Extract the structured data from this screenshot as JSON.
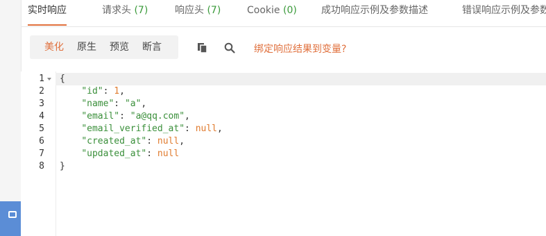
{
  "tabs": [
    {
      "label": "实时响应",
      "count": ""
    },
    {
      "label": "请求头",
      "count": "(7)"
    },
    {
      "label": "响应头",
      "count": "(7)"
    },
    {
      "label": "Cookie",
      "count": "(0)"
    },
    {
      "label": "成功响应示例及参数描述",
      "count": ""
    },
    {
      "label": "错误响应示例及参数描述",
      "count": ""
    }
  ],
  "toolbar": {
    "modes": [
      "美化",
      "原生",
      "预览",
      "断言"
    ],
    "active_mode": "美化",
    "bind_link": "绑定响应结果到变量?"
  },
  "editor": {
    "line_numbers": [
      "1",
      "2",
      "3",
      "4",
      "5",
      "6",
      "7",
      "8"
    ],
    "open_brace": "{",
    "close_brace": "}",
    "fields": [
      {
        "key": "\"id\"",
        "value": "1",
        "type": "number"
      },
      {
        "key": "\"name\"",
        "value": "\"a\"",
        "type": "string"
      },
      {
        "key": "\"email\"",
        "value": "\"a@qq.com\"",
        "type": "string"
      },
      {
        "key": "\"email_verified_at\"",
        "value": "null",
        "type": "null"
      },
      {
        "key": "\"created_at\"",
        "value": "null",
        "type": "null"
      },
      {
        "key": "\"updated_at\"",
        "value": "null",
        "type": "null"
      }
    ]
  },
  "colors": {
    "accent": "#e0703d",
    "string": "#3a8f3a",
    "number_null": "#e07b2e"
  }
}
